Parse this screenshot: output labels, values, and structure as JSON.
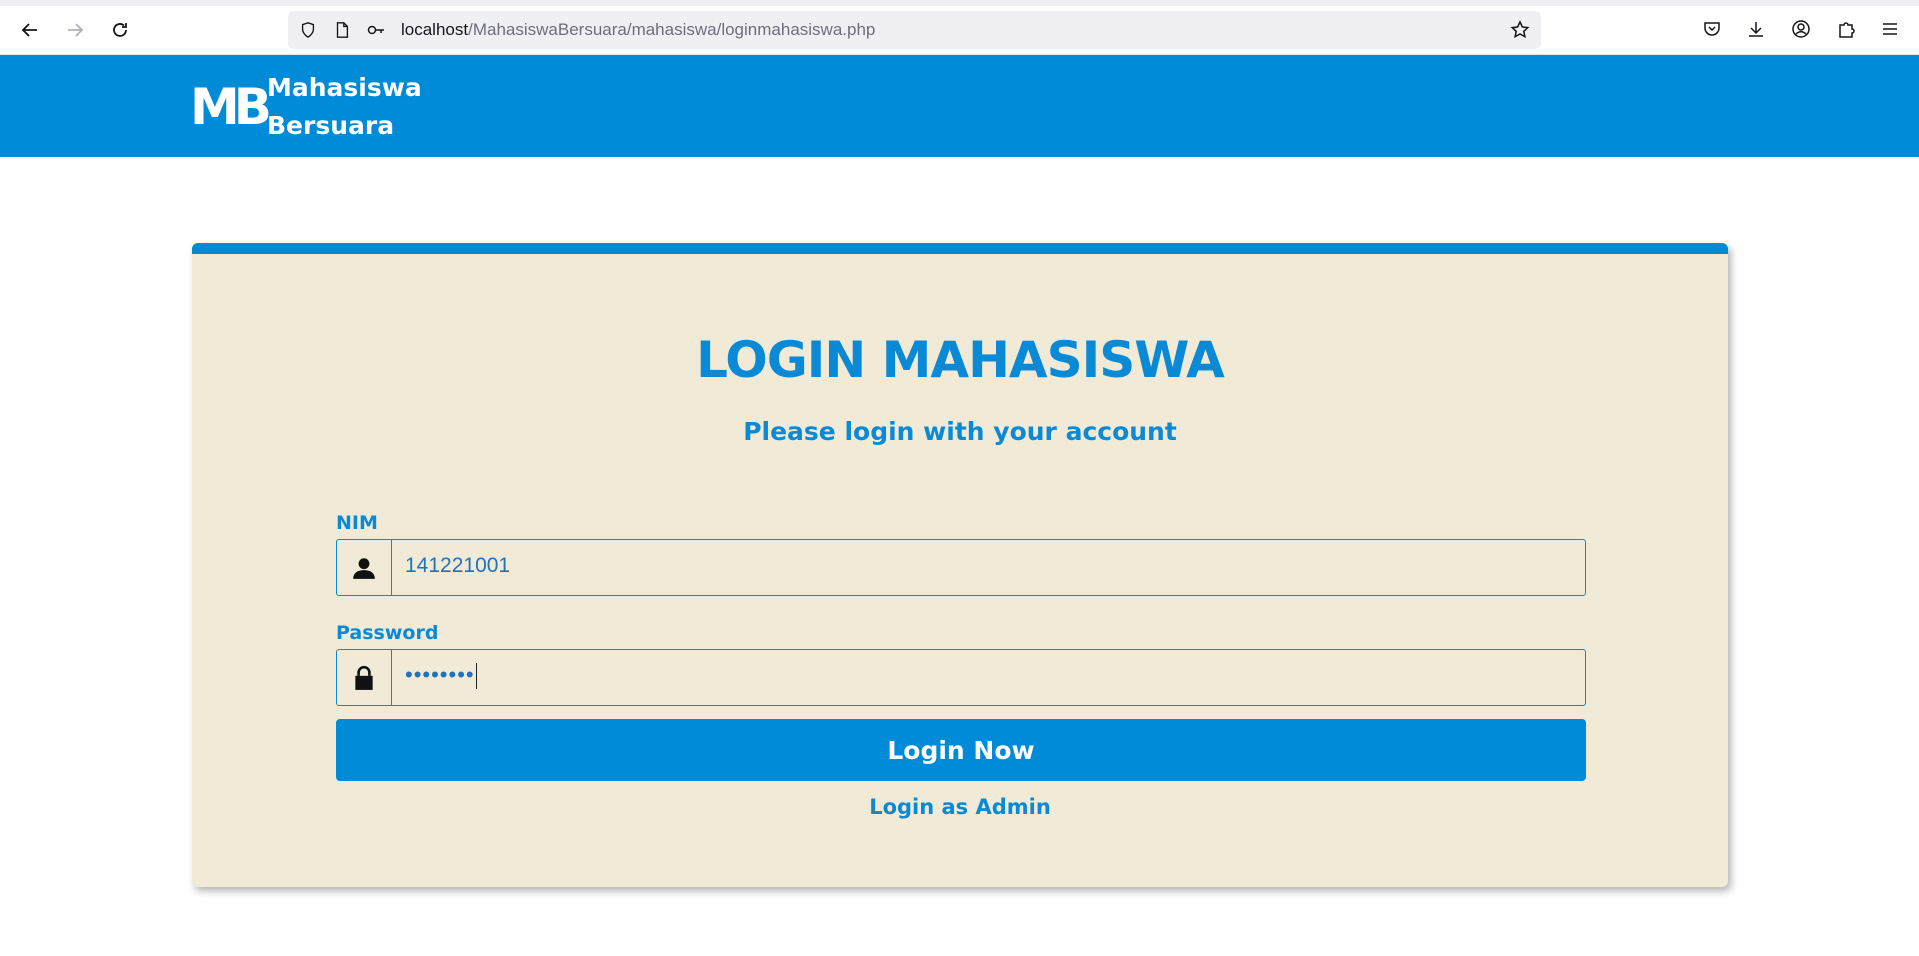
{
  "browser": {
    "url_host": "localhost",
    "url_path": "/MahasiswaBersuara/mahasiswa/loginmahasiswa.php"
  },
  "header": {
    "logo_mark": "MB",
    "brand_line1": "Mahasiswa",
    "brand_line2": "Bersuara"
  },
  "login": {
    "title": "LOGIN MAHASISWA",
    "subtitle": "Please login with your account",
    "nim_label": "NIM",
    "nim_value": "141221001",
    "password_label": "Password",
    "password_value": "••••••••",
    "submit_label": "Login Now",
    "admin_link": "Login as Admin"
  },
  "colors": {
    "primary": "#008bd9",
    "card_bg": "#f0ead6",
    "text_accent": "#0a8ad6"
  }
}
